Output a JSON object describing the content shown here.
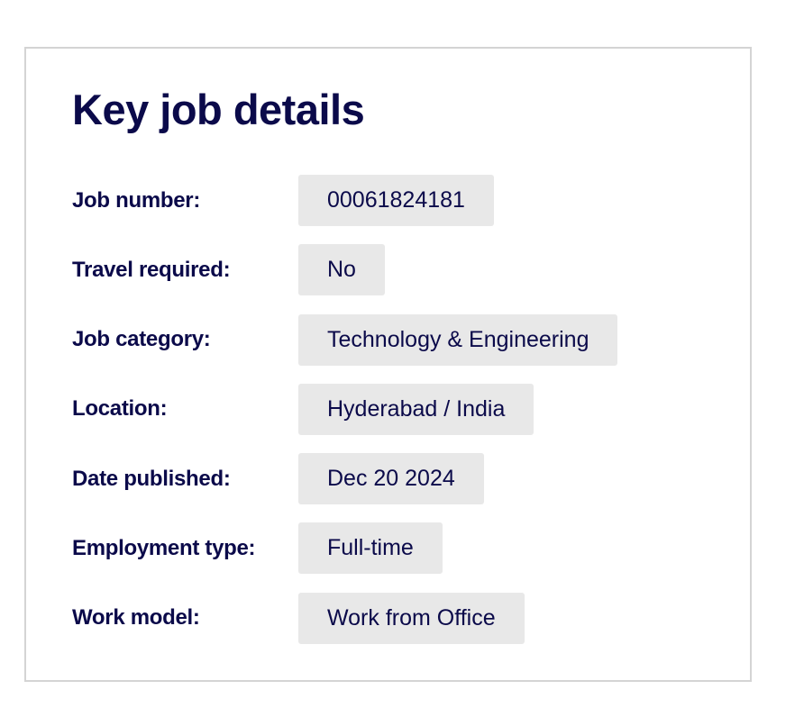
{
  "card": {
    "title": "Key job details",
    "details": [
      {
        "label": "Job number:",
        "value": "00061824181"
      },
      {
        "label": "Travel required:",
        "value": "No"
      },
      {
        "label": "Job category:",
        "value": "Technology & Engineering"
      },
      {
        "label": "Location:",
        "value": "Hyderabad / India"
      },
      {
        "label": "Date published:",
        "value": "Dec 20 2024"
      },
      {
        "label": "Employment type:",
        "value": "Full-time"
      },
      {
        "label": "Work model:",
        "value": "Work from Office"
      }
    ]
  },
  "colors": {
    "text": "#0b0a4a",
    "value_background": "#e8e8e8",
    "card_border": "#d4d4d4"
  }
}
